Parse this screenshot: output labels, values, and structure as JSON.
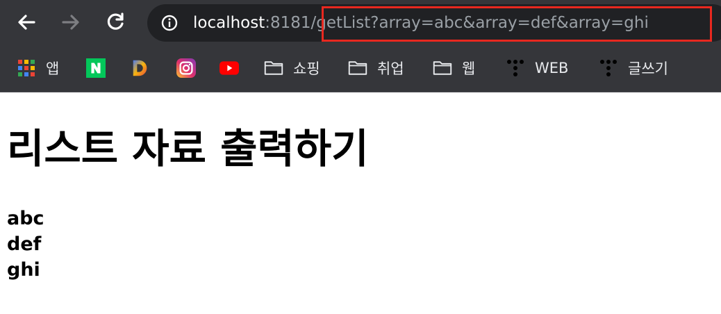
{
  "browser": {
    "url_host": "localhost",
    "url_port": ":8181",
    "url_path": "/getList?array=abc&array=def&array=ghi",
    "bookmarks": [
      {
        "label": "앱",
        "icon": "apps-grid-icon"
      },
      {
        "label": "",
        "icon": "naver-icon",
        "glyph": "N"
      },
      {
        "label": "",
        "icon": "daum-icon",
        "glyph": "D"
      },
      {
        "label": "",
        "icon": "instagram-icon"
      },
      {
        "label": "",
        "icon": "youtube-icon"
      },
      {
        "label": "쇼핑",
        "icon": "folder-icon"
      },
      {
        "label": "취업",
        "icon": "folder-icon"
      },
      {
        "label": "웹",
        "icon": "folder-icon"
      },
      {
        "label": "WEB",
        "icon": "tistory-icon"
      },
      {
        "label": "글쓰기",
        "icon": "tistory-icon"
      }
    ]
  },
  "page": {
    "title": "리스트 자료 출력하기",
    "items": [
      "abc",
      "def",
      "ghi"
    ]
  },
  "colors": {
    "chrome": "#35363a",
    "omnibox": "#202124",
    "highlight": "#e8281f"
  }
}
